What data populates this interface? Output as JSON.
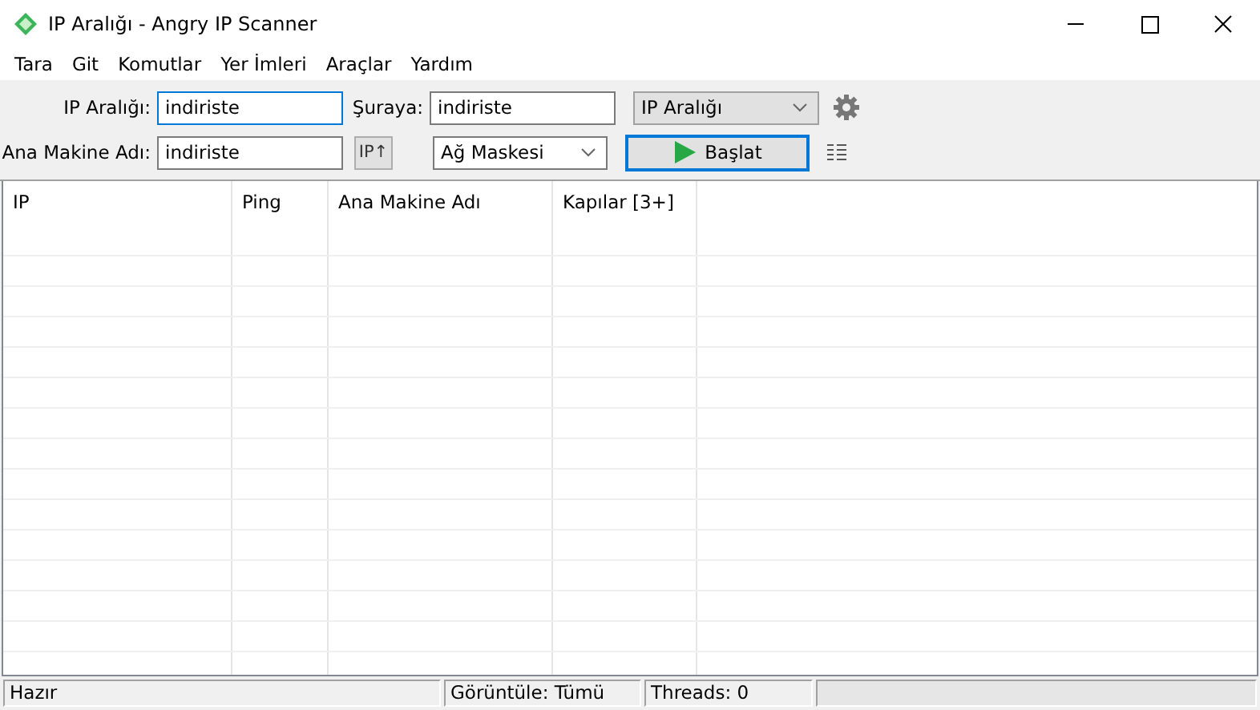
{
  "window": {
    "title": "IP Aralığı - Angry IP Scanner"
  },
  "menu": [
    "Tara",
    "Git",
    "Komutlar",
    "Yer İmleri",
    "Araçlar",
    "Yardım"
  ],
  "toolbar": {
    "range_label": "IP Aralığı:",
    "range_value": "indiriste",
    "to_label": "Şuraya:",
    "to_value": "indiriste",
    "feeder": "IP Aralığı",
    "hostname_label": "Ana Makine Adı:",
    "hostname_value": "indiriste",
    "ip_button": "IP↑",
    "netmask": "Ağ Maskesi",
    "start_button": "Başlat"
  },
  "table": {
    "columns": [
      "IP",
      "Ping",
      "Ana Makine Adı",
      "Kapılar [3+]"
    ]
  },
  "status_bar": {
    "status": "Hazır",
    "display": "Görüntüle: Tümü",
    "threads": "Threads: 0",
    "progress": {
      "level": 0
    }
  }
}
